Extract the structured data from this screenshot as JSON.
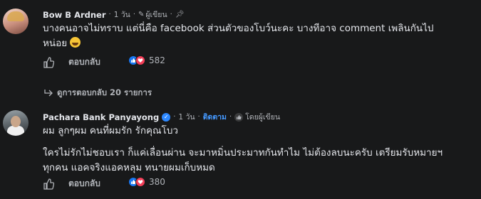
{
  "comments": [
    {
      "author": "Bow B Ardner",
      "time": "1 วัน",
      "badge": "ผู้เขียน",
      "text_line1": "บางคนอาจไม่ทราบ แต่นี่คือ facebook ส่วนตัวของโบว์นะคะ บางทีอาจ comment เพลินกันไป",
      "text_line2": "หน่อย",
      "reply_label": "ตอบกลับ",
      "reaction_count": "582"
    },
    {
      "author": "Pachara Bank Panyayong",
      "time": "1 วัน",
      "follow_label": "ติดตาม",
      "liked_by_label": "โดยผู้เขียน",
      "text_line1": "ผม ลูกๆผม คนที่ผมรัก รักคุณโบว",
      "text_line2": "ใครไม่รักไม่ชอบเรา ก็แค่เลื่อนผ่าน จะมาหมิ่นประมาทกันทำไม ไม่ต้องลบนะครับ เตรียมรับหมายฯ",
      "text_line3": "ทุกคน แอคจริงแอคหลุม ทนายผมเก็บหมด",
      "reply_label": "ตอบกลับ",
      "reaction_count": "380"
    }
  ],
  "view_replies_label": "ดูการตอบกลับ 20 รายการ"
}
